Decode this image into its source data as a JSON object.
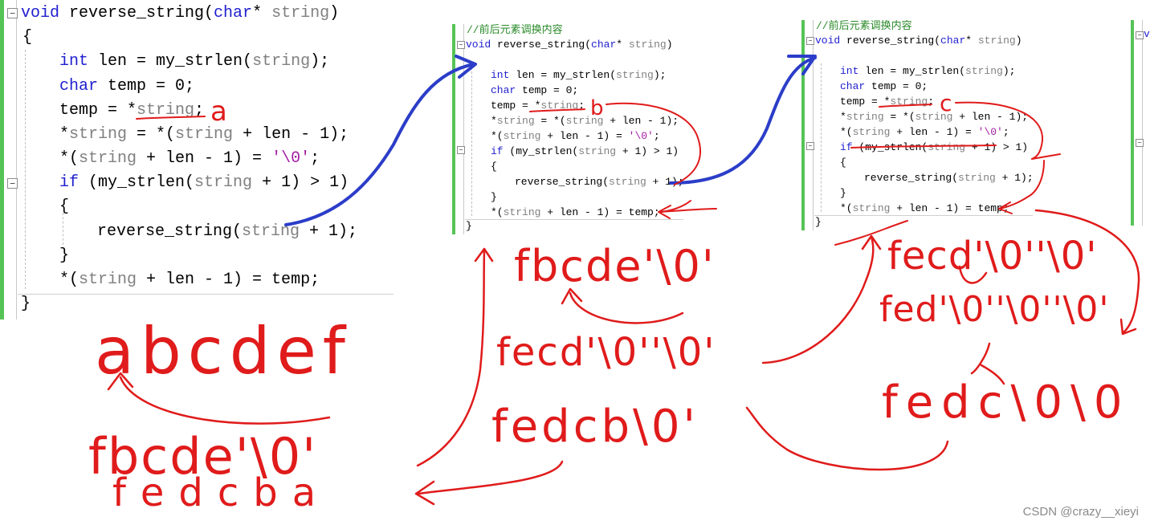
{
  "colors": {
    "keyword": "#1f1fcf",
    "param": "#808080",
    "string": "#a31fa3",
    "annotation_red": "#e01b1b",
    "annotation_blue": "#2b3dc8",
    "gutter_green": "#56c356"
  },
  "code": {
    "signature": {
      "kw": "void",
      "fn": " reverse_string(",
      "ty": "char",
      "star": "* ",
      "param": "string",
      "close": ")"
    },
    "open_brace": "{",
    "l_len": {
      "ty": "int",
      "rest": " len = my_strlen(",
      "param": "string",
      "end": ");"
    },
    "l_temp": {
      "ty": "char",
      "rest": " temp = 0;"
    },
    "l_assign": {
      "pre": "temp = *",
      "param": "string",
      "end": ";"
    },
    "l_swap": {
      "pre": "*",
      "p1": "string",
      "mid": " = *(",
      "p2": "string",
      "end": " + len - 1);"
    },
    "l_null": {
      "pre": "*(",
      "param": "string",
      "mid": " + len - 1) = ",
      "str": "'\\0'",
      "end": ";"
    },
    "l_if": {
      "kw": "if",
      "pre": " (my_strlen(",
      "param": "string",
      "end": " + 1) > 1)"
    },
    "l_inner_open": "{",
    "l_call": {
      "pre": "reverse_string(",
      "param": "string",
      "end": " + 1);"
    },
    "l_inner_close": "}",
    "l_restore": {
      "pre": "*(",
      "param": "string",
      "end": " + len - 1) = temp;"
    },
    "close_brace": "}",
    "fold_minus": "−"
  },
  "comment_partial": "//前后元素调换内容",
  "annotations": {
    "a": "a",
    "b": "b",
    "c": "c",
    "row1": "abcdef",
    "row2": "fbcde'\\0'",
    "row3": "fedcba",
    "p2_row1": "fbcde'\\0'",
    "p2_row2": "fecd'\\0''\\0'",
    "p2_row3": "fedcb\\0'",
    "p3_row1": "fecd'\\0''\\0'",
    "p3_row2": "fed'\\0''\\0''\\0'",
    "p3_row3": "fedc\\0\\0"
  },
  "watermark": "CSDN @crazy__xieyi"
}
